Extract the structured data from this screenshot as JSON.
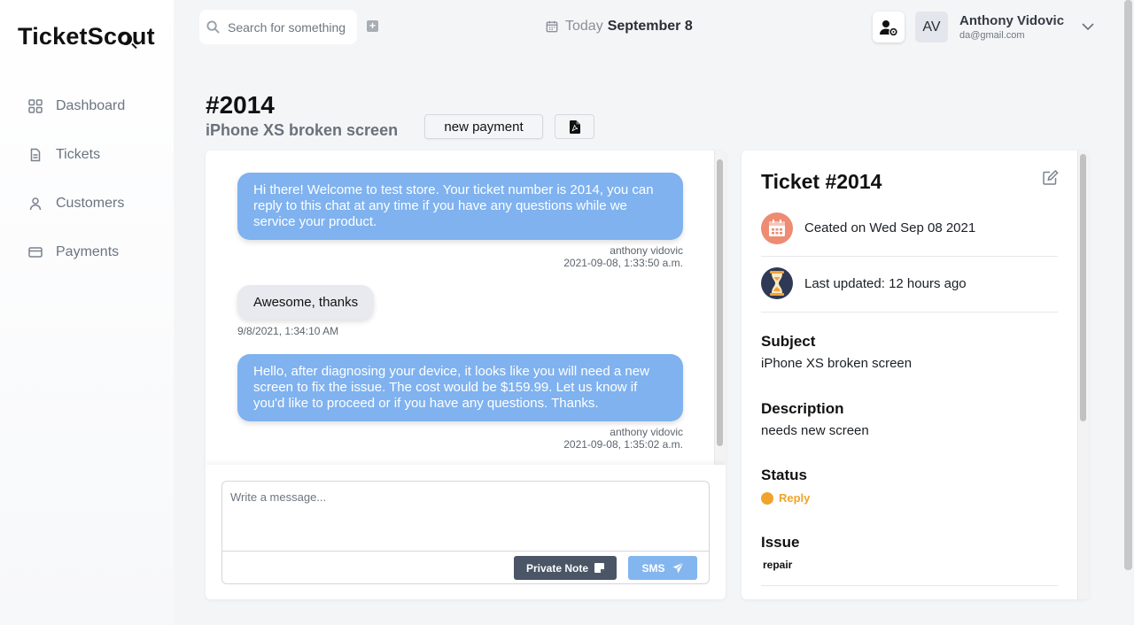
{
  "brand": {
    "name": "TicketScout"
  },
  "sidebar": {
    "items": [
      {
        "label": "Dashboard",
        "icon": "grid-icon"
      },
      {
        "label": "Tickets",
        "icon": "document-icon"
      },
      {
        "label": "Customers",
        "icon": "user-icon"
      },
      {
        "label": "Payments",
        "icon": "card-icon"
      }
    ]
  },
  "topbar": {
    "search_placeholder": "Search for something",
    "date_prefix": "Today",
    "date": "September 8",
    "avatar_initials": "AV",
    "user_name": "Anthony Vidovic",
    "user_email": "da@gmail.com"
  },
  "ticket": {
    "number": "#2014",
    "subtitle": "iPhone XS broken screen",
    "new_payment_label": "new payment"
  },
  "chat": {
    "messages": [
      {
        "direction": "out",
        "text": "Hi there! Welcome to test store. Your ticket number is 2014, you can reply to this chat at any time if you have any questions while we service your product.",
        "author": "anthony vidovic",
        "timestamp": "2021-09-08, 1:33:50 a.m."
      },
      {
        "direction": "in",
        "text": "Awesome, thanks",
        "timestamp": "9/8/2021, 1:34:10 AM"
      },
      {
        "direction": "out",
        "text": "Hello, after diagnosing your device, it looks like you will need a new screen to fix the issue. The cost would be $159.99. Let us know if you'd like to proceed or if you have any questions. Thanks.",
        "author": "anthony vidovic",
        "timestamp": "2021-09-08, 1:35:02 a.m."
      }
    ],
    "composer_placeholder": "Write a message...",
    "private_note_label": "Private Note",
    "sms_label": "SMS"
  },
  "details": {
    "title": "Ticket #2014",
    "created": "Ceated on Wed Sep 08 2021",
    "updated": "Last updated: 12 hours ago",
    "subject_label": "Subject",
    "subject": "iPhone XS broken screen",
    "description_label": "Description",
    "description": "needs new screen",
    "status_label": "Status",
    "status": "Reply",
    "status_color": "#f0a42a",
    "issue_label": "Issue",
    "issue": "repair"
  },
  "colors": {
    "bubble_out": "#7fb2ef",
    "bubble_in": "#e8eaef",
    "private_note": "#4a5566",
    "sms": "#83b5ef"
  }
}
